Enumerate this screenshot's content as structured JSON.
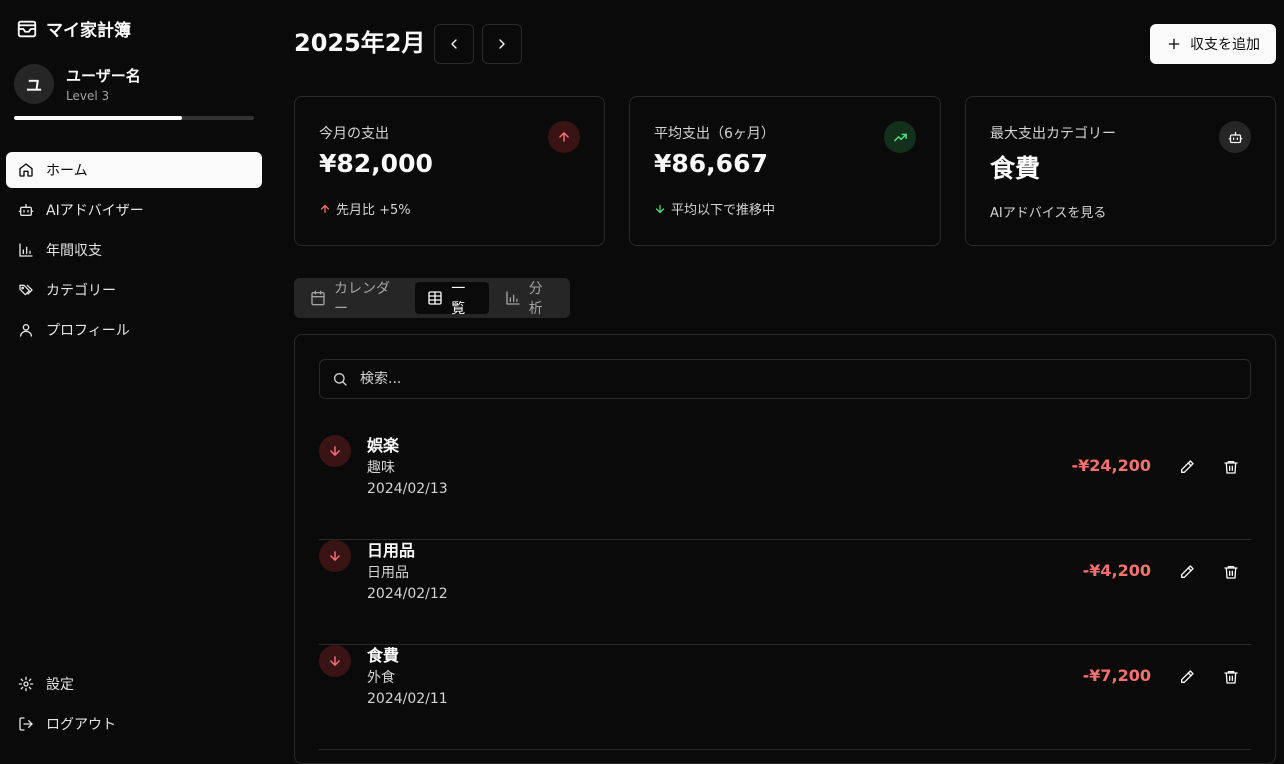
{
  "app": {
    "title": "マイ家計簿"
  },
  "user": {
    "initial": "ユ",
    "name": "ユーザー名",
    "level": "Level 3",
    "progress": 0.7
  },
  "nav": {
    "items": [
      {
        "label": "ホーム",
        "icon": "home-icon",
        "active": true
      },
      {
        "label": "AIアドバイザー",
        "icon": "bot-icon"
      },
      {
        "label": "年間収支",
        "icon": "bar-chart-icon"
      },
      {
        "label": "カテゴリー",
        "icon": "tags-icon"
      },
      {
        "label": "プロフィール",
        "icon": "user-icon"
      }
    ],
    "bottom": [
      {
        "label": "設定",
        "icon": "gear-icon"
      },
      {
        "label": "ログアウト",
        "icon": "logout-icon"
      }
    ]
  },
  "header": {
    "month": "2025年2月",
    "add_label": "収支を追加"
  },
  "cards": [
    {
      "label": "今月の支出",
      "value": "¥82,000",
      "sub": "先月比 +5%",
      "sub_color": "#f87171",
      "icon": "arrow-up-icon"
    },
    {
      "label": "平均支出（6ヶ月）",
      "value": "¥86,667",
      "sub": "平均以下で推移中",
      "sub_color": "#4ade80",
      "icon": "trending-up-icon"
    },
    {
      "label": "最大支出カテゴリー",
      "value": "食費",
      "sub": "AIアドバイスを見る",
      "icon": "bot-icon"
    }
  ],
  "tabs": [
    {
      "label": "カレンダー",
      "icon": "calendar-icon"
    },
    {
      "label": "一覧",
      "icon": "table-icon",
      "active": true
    },
    {
      "label": "分析",
      "icon": "bar-chart-icon"
    }
  ],
  "search": {
    "placeholder": "検索..."
  },
  "transactions": [
    {
      "category": "娯楽",
      "subcategory": "趣味",
      "date": "2024/02/13",
      "amount": "-¥24,200"
    },
    {
      "category": "日用品",
      "subcategory": "日用品",
      "date": "2024/02/12",
      "amount": "-¥4,200"
    },
    {
      "category": "食費",
      "subcategory": "外食",
      "date": "2024/02/11",
      "amount": "-¥7,200"
    }
  ]
}
